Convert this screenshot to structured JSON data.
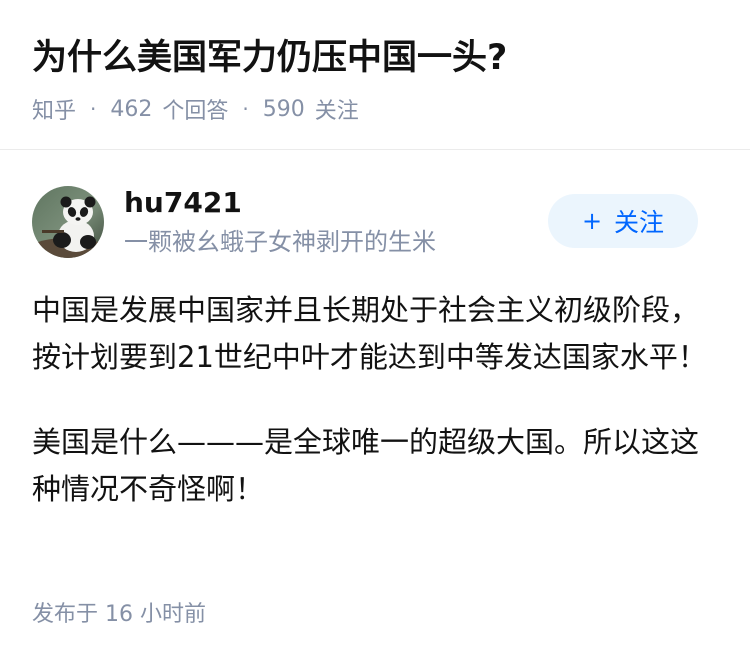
{
  "question": {
    "title": "为什么美国军力仍压中国一头?",
    "source": "知乎",
    "separator": "·",
    "answer_count": "462",
    "answer_label": "个回答",
    "follower_count": "590",
    "follower_label": "关注"
  },
  "answer": {
    "author": {
      "name": "hu7421",
      "bio": "一颗被幺蛾子女神剥开的生米"
    },
    "follow_button": {
      "icon": "+",
      "label": "关注"
    },
    "paragraphs": [
      "中国是发展中国家并且长期处于社会主义初级阶段，按计划要到21世纪中叶才能达到中等发达国家水平！",
      "美国是什么———是全球唯一的超级大国。所以这这种情况不奇怪啊！"
    ],
    "published": "发布于 16 小时前"
  },
  "colors": {
    "accent": "#0066ff",
    "follow_bg": "#ebf5fd",
    "meta_text": "#8590a6",
    "main_text": "#121212"
  }
}
